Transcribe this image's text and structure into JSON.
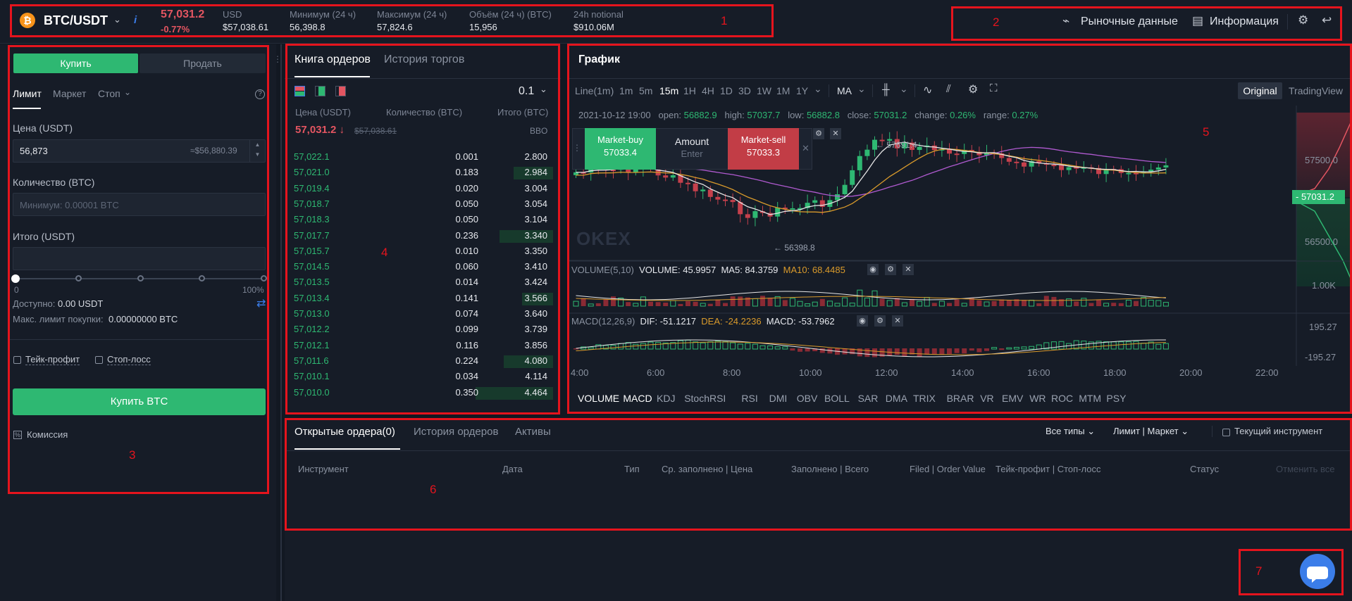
{
  "header": {
    "pair": "BTC/USDT",
    "coin_icon": "bitcoin-icon",
    "last_price": "57,031.2",
    "change": "-0.77%",
    "stats": [
      {
        "label": "USD",
        "value": "$57,038.61"
      },
      {
        "label": "Минимум (24 ч)",
        "value": "56,398.8"
      },
      {
        "label": "Максимум (24 ч)",
        "value": "57,824.6"
      },
      {
        "label": "Объём (24 ч) (BTC)",
        "value": "15,956"
      },
      {
        "label": "24h notional",
        "value": "$910.06M"
      }
    ],
    "market_data_link": "Рыночные данные",
    "info_link": "Информация"
  },
  "order_form": {
    "buy_tab": "Купить",
    "sell_tab": "Продать",
    "order_types": [
      "Лимит",
      "Маркет",
      "Стоп"
    ],
    "price_label": "Цена (USDT)",
    "price_value": "56,873",
    "price_usd": "≈$56,880.39",
    "qty_label": "Количество (BTC)",
    "qty_placeholder": "Минимум: 0.00001 BTC",
    "total_label": "Итого (USDT)",
    "slider_min": "0",
    "slider_max": "100%",
    "available_label": "Доступно:",
    "available_value": "0.00 USDT",
    "max_buy_label": "Макс. лимит покупки:",
    "max_buy_value": "0.00000000 BTC",
    "take_profit": "Тейк-профит",
    "stop_loss": "Стоп-лосс",
    "buy_button": "Купить BTC",
    "commission": "Комиссия"
  },
  "orderbook": {
    "tabs": [
      "Книга ордеров",
      "История торгов"
    ],
    "precision": "0.1",
    "col_price": "Цена (USDT)",
    "col_qty": "Количество (BTC)",
    "col_total": "Итого (BTC)",
    "mid_price": "57,031.2 ↓",
    "mid_usd": "$57,038.61",
    "bbo": "BBO",
    "rows": [
      {
        "price": "57,022.1",
        "qty": "0.001",
        "total": "2.800",
        "depth": 0.0
      },
      {
        "price": "57,021.0",
        "qty": "0.183",
        "total": "2.984",
        "depth": 0.28
      },
      {
        "price": "57,019.4",
        "qty": "0.020",
        "total": "3.004",
        "depth": 0.0
      },
      {
        "price": "57,018.7",
        "qty": "0.050",
        "total": "3.054",
        "depth": 0.0
      },
      {
        "price": "57,018.3",
        "qty": "0.050",
        "total": "3.104",
        "depth": 0.0
      },
      {
        "price": "57,017.7",
        "qty": "0.236",
        "total": "3.340",
        "depth": 0.38
      },
      {
        "price": "57,015.7",
        "qty": "0.010",
        "total": "3.350",
        "depth": 0.0
      },
      {
        "price": "57,014.5",
        "qty": "0.060",
        "total": "3.410",
        "depth": 0.0
      },
      {
        "price": "57,013.5",
        "qty": "0.014",
        "total": "3.424",
        "depth": 0.0
      },
      {
        "price": "57,013.4",
        "qty": "0.141",
        "total": "3.566",
        "depth": 0.22
      },
      {
        "price": "57,013.0",
        "qty": "0.074",
        "total": "3.640",
        "depth": 0.0
      },
      {
        "price": "57,012.2",
        "qty": "0.099",
        "total": "3.739",
        "depth": 0.0
      },
      {
        "price": "57,012.1",
        "qty": "0.116",
        "total": "3.856",
        "depth": 0.0
      },
      {
        "price": "57,011.6",
        "qty": "0.224",
        "total": "4.080",
        "depth": 0.35
      },
      {
        "price": "57,010.1",
        "qty": "0.034",
        "total": "4.114",
        "depth": 0.0
      },
      {
        "price": "57,010.0",
        "qty": "0.350",
        "total": "4.464",
        "depth": 0.55
      }
    ]
  },
  "chart": {
    "title": "График",
    "timeframes": [
      "Line(1m)",
      "1m",
      "5m",
      "15m",
      "1H",
      "4H",
      "1D",
      "3D",
      "1W",
      "1M",
      "1Y"
    ],
    "active_timeframe": "15m",
    "ma_label": "MA",
    "view_original": "Original",
    "view_tradingview": "TradingView",
    "ohlc": {
      "date": "2021-10-12 19:00",
      "open_label": "open:",
      "open": "56882.9",
      "high_label": "high:",
      "high": "57037.7",
      "low_label": "low:",
      "low": "56882.8",
      "close_label": "close:",
      "close": "57031.2",
      "change_label": "change:",
      "change": "0.26%",
      "range_label": "range:",
      "range": "0.27%"
    },
    "quick_trade": {
      "buy_label": "Market-buy",
      "buy_price": "57033.4",
      "amount_label": "Amount",
      "amount_ph": "Enter",
      "sell_label": "Market-sell",
      "sell_price": "57033.3"
    },
    "price_marks": {
      "high": "57691.4",
      "low": "56398.8"
    },
    "y_ticks": [
      "57500.0",
      "56500.0"
    ],
    "current_price": "57031.2",
    "volume_legend": {
      "name": "VOLUME(5,10)",
      "vol": "VOLUME: 45.9957",
      "ma5": "MA5: 84.3759",
      "ma10": "MA10: 68.4485"
    },
    "volume_tick": "1.00K",
    "macd_legend": {
      "name": "MACD(12,26,9)",
      "dif": "DIF: -51.1217",
      "dea": "DEA: -24.2236",
      "macd": "MACD: -53.7962"
    },
    "macd_ticks": [
      "195.27",
      "-195.27"
    ],
    "x_ticks": [
      "4:00",
      "6:00",
      "8:00",
      "10:00",
      "12:00",
      "14:00",
      "16:00",
      "18:00",
      "20:00",
      "22:00"
    ],
    "indicators": [
      "VOLUME",
      "MACD",
      "KDJ",
      "StochRSI",
      "RSI",
      "DMI",
      "OBV",
      "BOLL",
      "SAR",
      "DMA",
      "TRIX",
      "BRAR",
      "VR",
      "EMV",
      "WR",
      "ROC",
      "MTM",
      "PSY"
    ],
    "watermark": "OKEX"
  },
  "orders": {
    "tabs": [
      "Открытые ордера(0)",
      "История ордеров",
      "Активы"
    ],
    "filter_types": "Все типы",
    "filter_kind": "Лимит | Маркет",
    "current_instrument": "Текущий инструмент",
    "columns": [
      "Инструмент",
      "Дата",
      "Тип",
      "Ср. заполнено | Цена",
      "Заполнено | Всего",
      "Filed | Order Value",
      "Тейк-профит | Стоп-лосс",
      "Статус"
    ],
    "cancel_all": "Отменить все"
  },
  "annotations": [
    "1",
    "2",
    "3",
    "4",
    "5",
    "6",
    "7"
  ],
  "colors": {
    "buy": "#2eb872",
    "sell": "#e35561",
    "accent": "#3b7de9",
    "background": "#121822"
  }
}
